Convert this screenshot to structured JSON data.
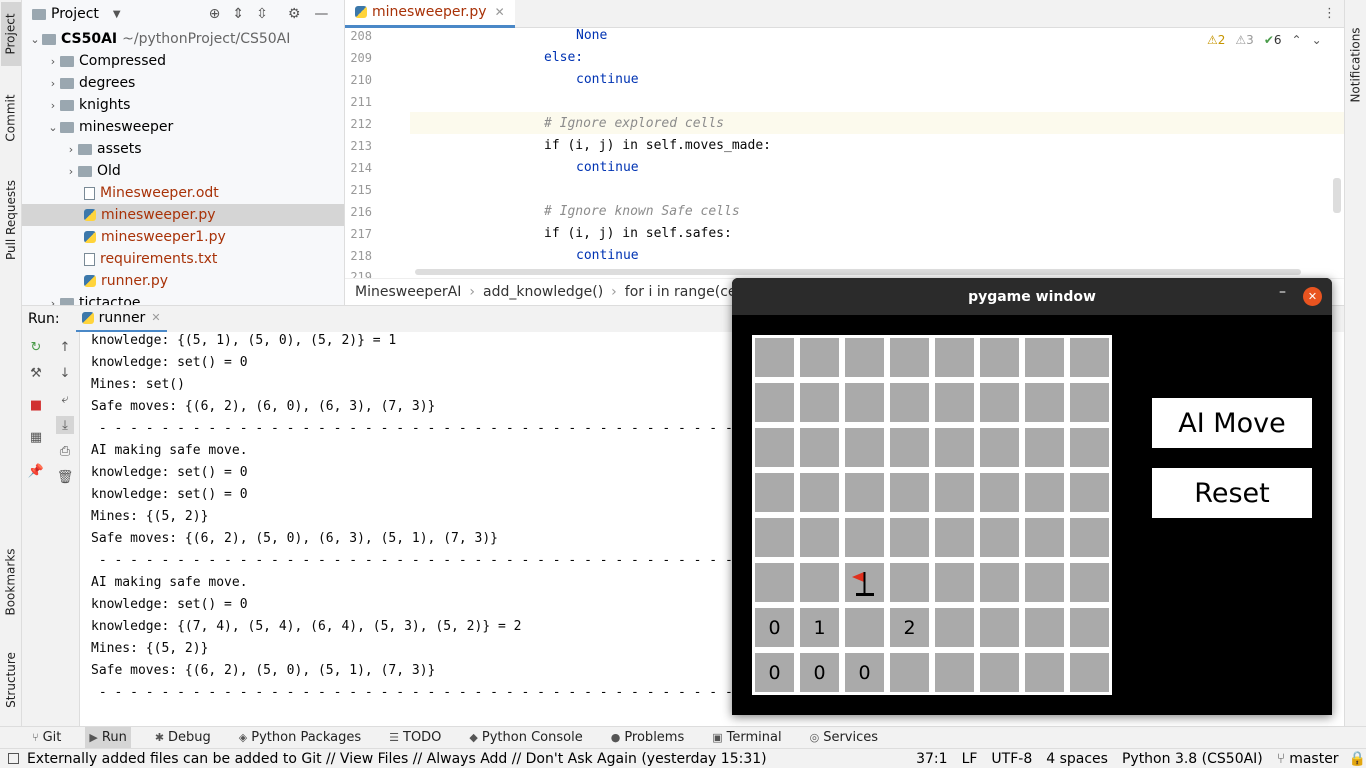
{
  "left_strip": {
    "project": "Project",
    "commit": "Commit",
    "pull_requests": "Pull Requests",
    "bookmarks": "Bookmarks",
    "structure": "Structure"
  },
  "right_strip": {
    "notifications": "Notifications"
  },
  "project_panel": {
    "title": "Project",
    "root_name": "CS50AI",
    "root_path": "~/pythonProject/CS50AI",
    "items": [
      {
        "label": "Compressed",
        "type": "folder",
        "level": 1
      },
      {
        "label": "degrees",
        "type": "folder",
        "level": 1
      },
      {
        "label": "knights",
        "type": "folder",
        "level": 1
      },
      {
        "label": "minesweeper",
        "type": "folder",
        "level": 1,
        "expanded": true
      },
      {
        "label": "assets",
        "type": "folder",
        "level": 2
      },
      {
        "label": "Old",
        "type": "folder",
        "level": 2
      },
      {
        "label": "Minesweeper.odt",
        "type": "file",
        "level": 2
      },
      {
        "label": "minesweeper.py",
        "type": "py",
        "level": 2,
        "selected": true
      },
      {
        "label": "minesweeper1.py",
        "type": "py",
        "level": 2
      },
      {
        "label": "requirements.txt",
        "type": "file",
        "level": 2
      },
      {
        "label": "runner.py",
        "type": "py",
        "level": 2
      },
      {
        "label": "tictactoe",
        "type": "folder",
        "level": 1
      }
    ]
  },
  "editor": {
    "tab": "minesweeper.py",
    "inspections": {
      "warnings": "2",
      "weak_warnings": "3",
      "ok": "6"
    },
    "lines": [
      {
        "n": "208",
        "text": "None"
      },
      {
        "n": "209",
        "text": "else:"
      },
      {
        "n": "210",
        "text": "continue"
      },
      {
        "n": "211",
        "text": ""
      },
      {
        "n": "212",
        "text": "# Ignore explored cells"
      },
      {
        "n": "213",
        "text": "if (i, j) in self.moves_made:"
      },
      {
        "n": "214",
        "text": "continue"
      },
      {
        "n": "215",
        "text": ""
      },
      {
        "n": "216",
        "text": "# Ignore known Safe cells"
      },
      {
        "n": "217",
        "text": "if (i, j) in self.safes:"
      },
      {
        "n": "218",
        "text": "continue"
      },
      {
        "n": "219",
        "text": ""
      }
    ],
    "breadcrumb": [
      "MinesweeperAI",
      "add_knowledge()",
      "for i in range(cel"
    ]
  },
  "run": {
    "label": "Run:",
    "tab": "runner",
    "console": [
      "knowledge: {(5, 1), (5, 0), (5, 2)} = 1",
      "knowledge: set() = 0",
      "Mines: set()",
      "Safe moves: {(6, 2), (6, 0), (6, 3), (7, 3)}",
      " - - - - - - - - - - - - - - - - - - - - - - - - - - - - - - - - - - - - - - - - - - - - - -",
      "AI making safe move.",
      "knowledge: set() = 0",
      "knowledge: set() = 0",
      "Mines: {(5, 2)}",
      "Safe moves: {(6, 2), (5, 0), (6, 3), (5, 1), (7, 3)}",
      " - - - - - - - - - - - - - - - - - - - - - - - - - - - - - - - - - - - - - - - - - - - - - -",
      "AI making safe move.",
      "knowledge: set() = 0",
      "knowledge: {(7, 4), (5, 4), (6, 4), (5, 3), (5, 2)} = 2",
      "Mines: {(5, 2)}",
      "Safe moves: {(6, 2), (5, 0), (5, 1), (7, 3)}",
      " - - - - - - - - - - - - - - - - - - - - - - - - - - - - - - - - - - - - - - - - - - - - - -"
    ]
  },
  "bottom_tabs": [
    "Git",
    "Run",
    "Debug",
    "Python Packages",
    "TODO",
    "Python Console",
    "Problems",
    "Terminal",
    "Services"
  ],
  "status_bar": {
    "message": "Externally added files can be added to Git // View Files // Always Add // Don't Ask Again (yesterday 15:31)",
    "position": "37:1",
    "line_sep": "LF",
    "encoding": "UTF-8",
    "indent": "4 spaces",
    "interpreter": "Python 3.8 (CS50AI)",
    "branch": "master"
  },
  "pygame": {
    "title": "pygame window",
    "ai_move": "AI Move",
    "reset": "Reset",
    "board": [
      [
        "",
        "",
        "",
        "",
        "",
        "",
        "",
        ""
      ],
      [
        "",
        "",
        "",
        "",
        "",
        "",
        "",
        ""
      ],
      [
        "",
        "",
        "",
        "",
        "",
        "",
        "",
        ""
      ],
      [
        "",
        "",
        "",
        "",
        "",
        "",
        "",
        ""
      ],
      [
        "",
        "",
        "",
        "",
        "",
        "",
        "",
        ""
      ],
      [
        "",
        "",
        "F",
        "",
        "",
        "",
        "",
        ""
      ],
      [
        "0",
        "1",
        "",
        "2",
        "",
        "",
        "",
        ""
      ],
      [
        "0",
        "0",
        "0",
        "",
        "",
        "",
        "",
        ""
      ]
    ]
  }
}
